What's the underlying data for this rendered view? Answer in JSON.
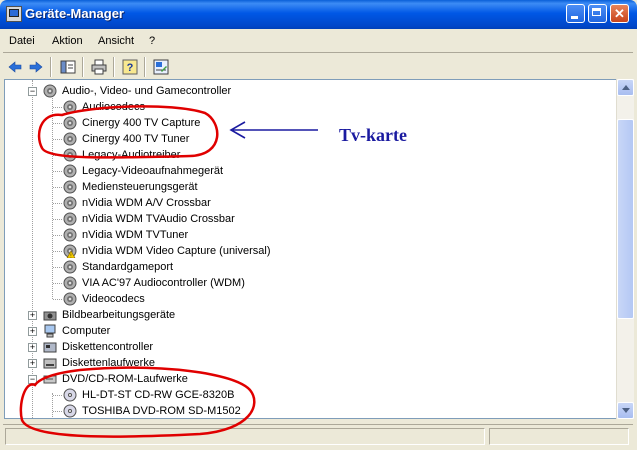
{
  "window": {
    "title": "Geräte-Manager"
  },
  "titlebar_buttons": {
    "minimize": "",
    "maximize": "",
    "close": "✕"
  },
  "menu": {
    "items": [
      "Datei",
      "Aktion",
      "Ansicht",
      "?"
    ]
  },
  "toolbar": {
    "icons": [
      "back-arrow-icon",
      "forward-arrow-icon",
      "console-tree-icon",
      "print-icon",
      "help-icon",
      "properties-icon"
    ]
  },
  "tree": {
    "audio_category": "Audio-, Video- und Gamecontroller",
    "audio_devices": [
      "Audiocodecs",
      "Cinergy 400 TV Capture",
      "Cinergy 400 TV Tuner",
      "Legacy-Audiotreiber",
      "Legacy-Videoaufnahmegerät",
      "Mediensteuerungsgerät",
      "nVidia WDM A/V Crossbar",
      "nVidia WDM TVAudio Crossbar",
      "nVidia WDM TVTuner",
      "nVidia WDM Video Capture (universal)",
      "Standardgameport",
      "VIA AC'97 Audiocontroller (WDM)",
      "Videocodecs"
    ],
    "other_categories": [
      "Bildbearbeitungsgeräte",
      "Computer",
      "Diskettencontroller",
      "Diskettenlaufwerke"
    ],
    "dvd_category": "DVD/CD-ROM-Laufwerke",
    "dvd_devices": [
      "HL-DT-ST CD-RW GCE-8320B",
      "TOSHIBA DVD-ROM SD-M1502"
    ]
  },
  "annotation": {
    "label": "Tv-karte",
    "color": "#e00000",
    "text_color": "#1a1aa0"
  }
}
